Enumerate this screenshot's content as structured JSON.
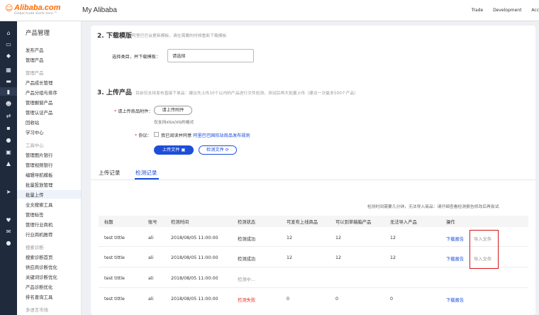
{
  "header": {
    "logo_text": "Alibaba.com",
    "logo_tagline": "Global trade starts here.™",
    "site_title": "My Alibaba",
    "links": [
      "Trade",
      "Development",
      "Acc"
    ]
  },
  "sidebar": {
    "title": "产品管理",
    "items": [
      {
        "label": "发布产品",
        "type": "item"
      },
      {
        "label": "管理产品",
        "type": "item"
      },
      {
        "label": "管理产品",
        "type": "section"
      },
      {
        "label": "产品成长管理",
        "type": "item"
      },
      {
        "label": "产品分组与排序",
        "type": "item"
      },
      {
        "label": "管理橱窗产品",
        "type": "item"
      },
      {
        "label": "管理认证产品",
        "type": "item"
      },
      {
        "label": "回收站",
        "type": "item"
      },
      {
        "label": "学习中心",
        "type": "item"
      },
      {
        "label": "工具中心",
        "type": "section"
      },
      {
        "label": "管理图片银行",
        "type": "item"
      },
      {
        "label": "管理视频银行",
        "type": "item"
      },
      {
        "label": "编辑导航模板",
        "type": "item"
      },
      {
        "label": "批量投放管理",
        "type": "item"
      },
      {
        "label": "批量上传",
        "type": "item",
        "active": true
      },
      {
        "label": "全文搜索工具",
        "type": "item"
      },
      {
        "label": "管理标签",
        "type": "item"
      },
      {
        "label": "管理行业商机",
        "type": "item"
      },
      {
        "label": "行业商机推荐",
        "type": "item"
      },
      {
        "label": "搜索诊断",
        "type": "section"
      },
      {
        "label": "搜索诊断首页",
        "type": "item"
      },
      {
        "label": "供应商诊断优化",
        "type": "item"
      },
      {
        "label": "关键词诊断优化",
        "type": "item"
      },
      {
        "label": "产品诊断优化",
        "type": "item"
      },
      {
        "label": "排名查询工具",
        "type": "item"
      },
      {
        "label": "多语言市场",
        "type": "section"
      }
    ]
  },
  "download": {
    "heading": "2. 下载模版",
    "hint": "阿里巴巴会更新模板，请在需要的时候重新下载模板",
    "select_label": "选择类目，并下载模板：",
    "select_value": "请选择"
  },
  "upload": {
    "heading": "3. 上传产品",
    "hint": "目前仅支持发布直接下单品：建议先上传10个以内的产品进行文件检测，测试后再大批量上传（建议一次最多500个产品）",
    "attachment_label": "请上传商品附件：",
    "attachment_button": "请上传附件",
    "attachment_hint": "仅支持xlsx/xls的格式",
    "agreement_label": "协议：",
    "agreement_text": "我已阅读并同意",
    "agreement_link": "阿里巴巴国际站商品发布规则",
    "upload_button": "上传文件",
    "check_button": "检测文件"
  },
  "tabs": [
    {
      "label": "上传记录",
      "active": false
    },
    {
      "label": "检测记录",
      "active": true
    }
  ],
  "notice": "检测时间需要几分钟，无法导入商品：请仔细查看检测报告修改后再尝试",
  "table": {
    "columns": [
      "标题",
      "账号",
      "检测时间",
      "检测状态",
      "可发布上线商品",
      "可以到草稿箱产品",
      "无法导入产品",
      "操作"
    ],
    "rows": [
      {
        "title": "test tittle",
        "account": "ali",
        "time": "2018/08/05 11:00:00",
        "status": "检测成功",
        "status_type": "ok",
        "publishable": "12",
        "draft": "12",
        "failed": "12",
        "report": "下载报告",
        "import": "导入文件"
      },
      {
        "title": "test tittle",
        "account": "ali",
        "time": "2018/08/05 11:00:00",
        "status": "检测成功",
        "status_type": "ok",
        "publishable": "12",
        "draft": "12",
        "failed": "12",
        "report": "下载报告",
        "import": "导入文件"
      },
      {
        "title": "test tittle",
        "account": "ali",
        "time": "2018/08/05 11:00:00",
        "status": "检测中...",
        "status_type": "pending",
        "publishable": "",
        "draft": "",
        "failed": "",
        "report": "",
        "import": ""
      },
      {
        "title": "test tittle",
        "account": "ali",
        "time": "2018/08/05 11:00:00",
        "status": "检测失败",
        "status_type": "fail",
        "publishable": "0",
        "draft": "0",
        "failed": "0",
        "report": "下载报告",
        "import": ""
      }
    ]
  },
  "colors": {
    "brand": "#ff6a00",
    "primary": "#1d4ed8",
    "error": "#e3372a",
    "highlight": "#d4161b"
  }
}
